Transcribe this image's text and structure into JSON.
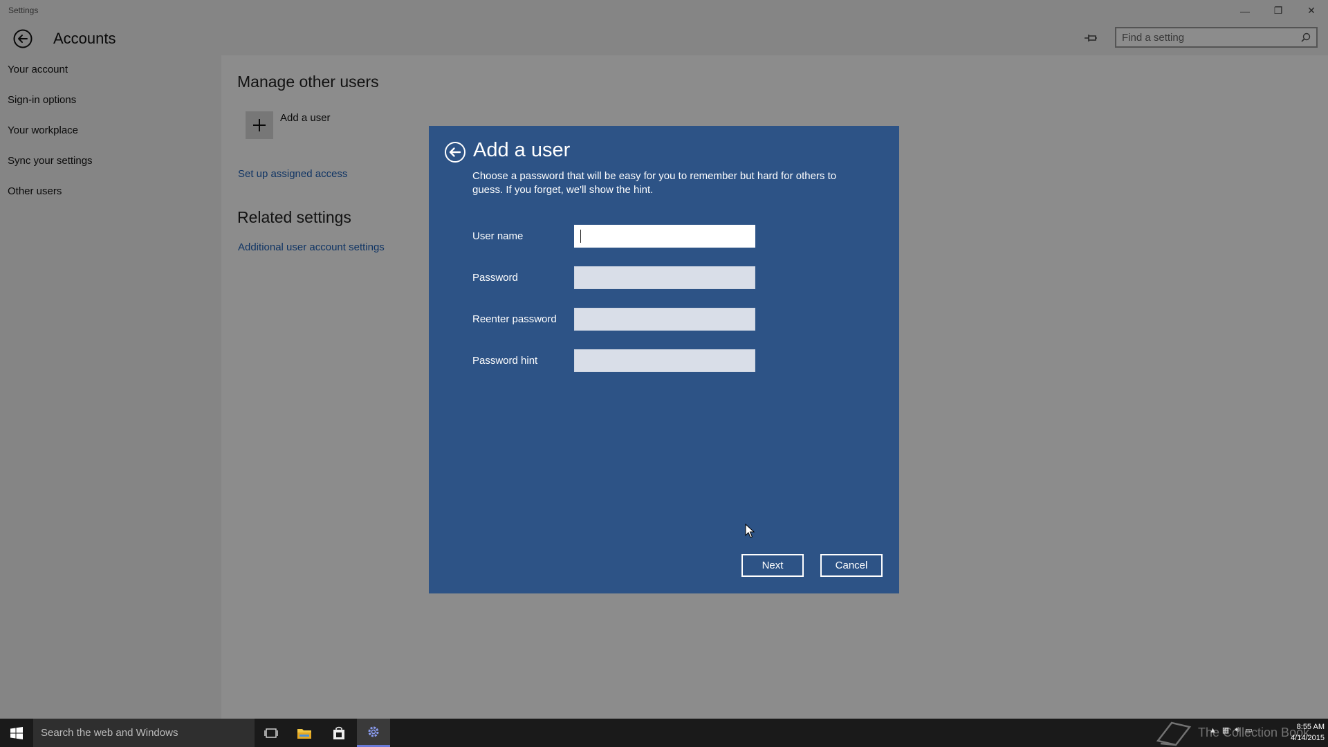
{
  "window": {
    "app_title": "Settings",
    "controls": {
      "minimize": "—",
      "restore": "❐",
      "close": "✕"
    }
  },
  "header": {
    "title": "Accounts",
    "search_placeholder": "Find a setting"
  },
  "sidebar": {
    "items": [
      {
        "label": "Your account"
      },
      {
        "label": "Sign-in options"
      },
      {
        "label": "Your workplace"
      },
      {
        "label": "Sync your settings"
      },
      {
        "label": "Other users"
      }
    ]
  },
  "content": {
    "manage_title": "Manage other users",
    "add_user_label": "Add a user",
    "assigned_access_link": "Set up assigned access",
    "related_title": "Related settings",
    "additional_link": "Additional user account settings"
  },
  "dialog": {
    "title": "Add a user",
    "description": "Choose a password that will be easy for you to remember but hard for others to guess. If you forget, we'll show the hint.",
    "fields": [
      {
        "label": "User name",
        "value": ""
      },
      {
        "label": "Password",
        "value": ""
      },
      {
        "label": "Reenter password",
        "value": ""
      },
      {
        "label": "Password hint",
        "value": ""
      }
    ],
    "next_label": "Next",
    "cancel_label": "Cancel"
  },
  "taskbar": {
    "search_placeholder": "Search the web and Windows",
    "watermark_text": "The Collection Book",
    "time": "8:55 AM",
    "date": "4/14/2015"
  },
  "colors": {
    "dialog_bg": "#2d5386",
    "link": "#1d5fb6",
    "taskbar": "#1a1a1a"
  }
}
